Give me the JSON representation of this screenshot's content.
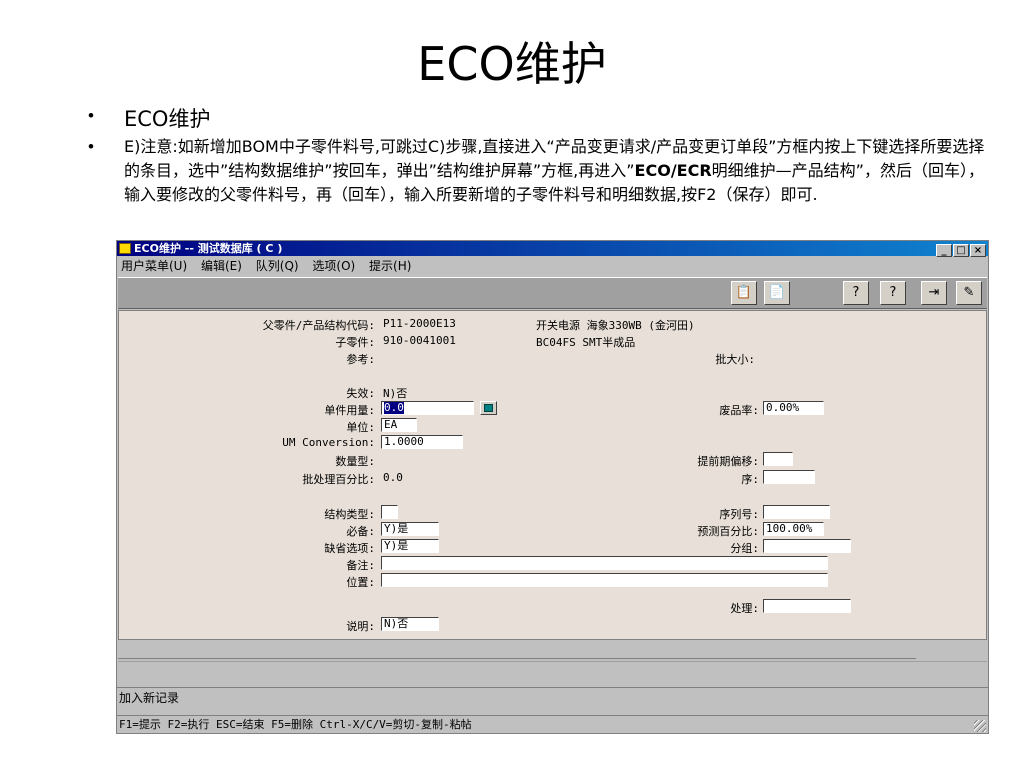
{
  "slide": {
    "title": "ECO维护",
    "bullet1": "ECO维护",
    "bullet2_a": "E)注意:如新增加BOM中子零件料号,可跳过C)步骤,直接进入“产品变更请求/产品变更订单段”方框内按上下键选择所要选择的条目，选中”结构数据维护”按回车，弹出”结构维护屏幕”方框,再进入”",
    "bullet2_b": "ECO/ECR",
    "bullet2_c": "明细维护—产品结构”，然后（回车），输入要修改的父零件料号，再（回车），输入所要新增的子零件料号和明细数据,按F2（保存）即可."
  },
  "window": {
    "title": "ECO维护 -- 测试数据库 ( C )",
    "btn_min": "_",
    "btn_max": "□",
    "btn_close": "×"
  },
  "menu": {
    "items": [
      "用户菜单(U)",
      "编辑(E)",
      "队列(Q)",
      "选项(O)",
      "提示(H)"
    ]
  },
  "toolbar": {
    "icons": [
      "copy-icon",
      "paste-icon",
      "help-icon",
      "help-context-icon",
      "exit-icon",
      "edit-icon"
    ]
  },
  "form": {
    "parent_label": "父零件/产品结构代码:",
    "parent_value": "P11-2000E13",
    "parent_desc": "开关电源 海象330WB (金河田)",
    "child_label": "子零件:",
    "child_value": "910-0041001",
    "child_desc": "BC04FS SMT半成品",
    "ref_label": "参考:",
    "batch_label": "批大小:",
    "expire_label": "失效:",
    "expire_value": "N)否",
    "qty_label": "单件用量:",
    "qty_value": "0.0",
    "scrap_label": "废品率:",
    "scrap_value": "0.00%",
    "unit_label": "单位:",
    "unit_value": "EA",
    "um_label": "UM Conversion:",
    "um_value": "1.0000",
    "qtytype_label": "数量型:",
    "leadtime_label": "提前期偏移:",
    "batchpct_label": "批处理百分比:",
    "batchpct_value": "0.0",
    "seq_label": "序:",
    "structtype_label": "结构类型:",
    "serial_label": "序列号:",
    "required_label": "必备:",
    "required_value": "Y)是",
    "forecast_label": "预测百分比:",
    "forecast_value": "100.00%",
    "default_label": "缺省选项:",
    "default_value": "Y)是",
    "group_label": "分组:",
    "remark_label": "备注:",
    "position_label": "位置:",
    "process_label": "处理:",
    "desc_label": "说明:",
    "desc_value": "N)否"
  },
  "status": {
    "message": "加入新记录",
    "keys": "F1=提示 F2=执行 ESC=结束 F5=删除 Ctrl-X/C/V=剪切-复制-粘帖"
  }
}
